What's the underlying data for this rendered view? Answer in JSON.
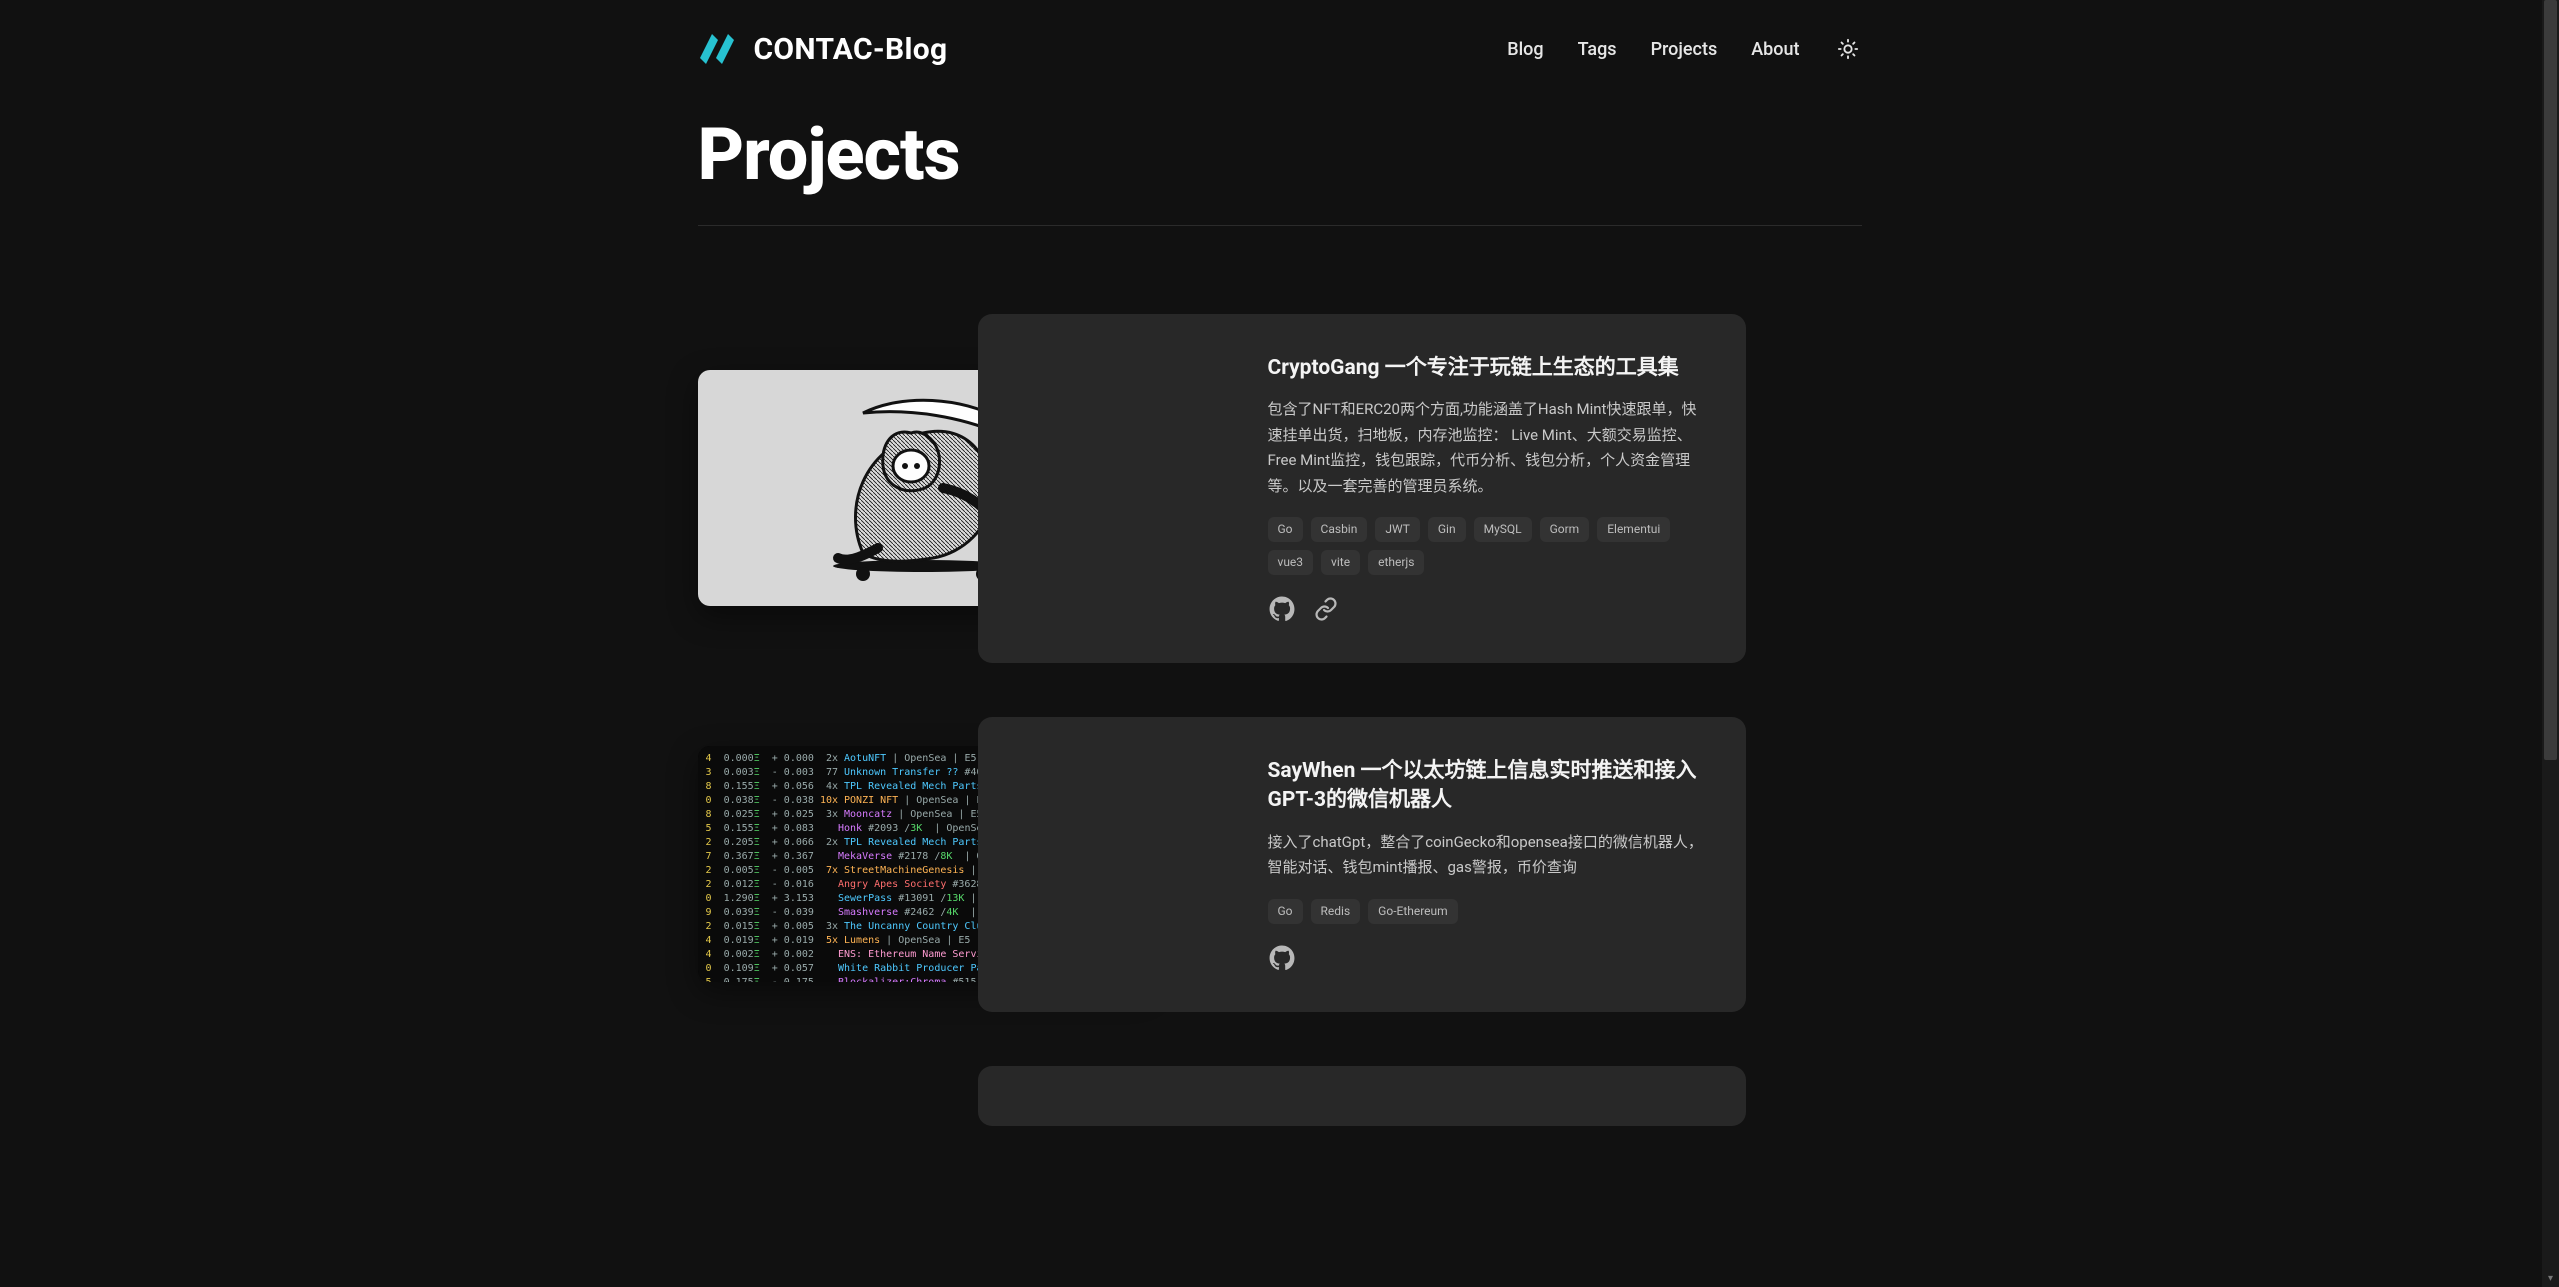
{
  "site": {
    "title": "CONTAC-Blog"
  },
  "nav": {
    "blog": "Blog",
    "tags": "Tags",
    "projects": "Projects",
    "about": "About"
  },
  "page": {
    "heading": "Projects"
  },
  "projects": [
    {
      "title": "CryptoGang 一个专注于玩链上生态的工具集",
      "desc": "包含了NFT和ERC20两个方面,功能涵盖了Hash Mint快速跟单，快速挂单出货，扫地板，内存池监控： Live Mint、大额交易监控、Free Mint监控，钱包跟踪，代币分析、钱包分析，个人资金管理等。以及一套完善的管理员系统。",
      "tags": [
        "Go",
        "Casbin",
        "JWT",
        "Gin",
        "MySQL",
        "Gorm",
        "Elementui",
        "vue3",
        "vite",
        "etherjs"
      ]
    },
    {
      "title": "SayWhen 一个以太坊链上信息实时推送和接入GPT-3的微信机器人",
      "desc": "接入了chatGpt，整合了coinGecko和opensea接口的微信机器人，智能对话、钱包mint播报、gas警报，币价查询",
      "tags": [
        "Go",
        "Redis",
        "Go-Ethereum"
      ]
    }
  ],
  "icons": {
    "logo": "site-logo",
    "sun": "sun-icon",
    "github": "github-icon",
    "link": "link-icon"
  }
}
